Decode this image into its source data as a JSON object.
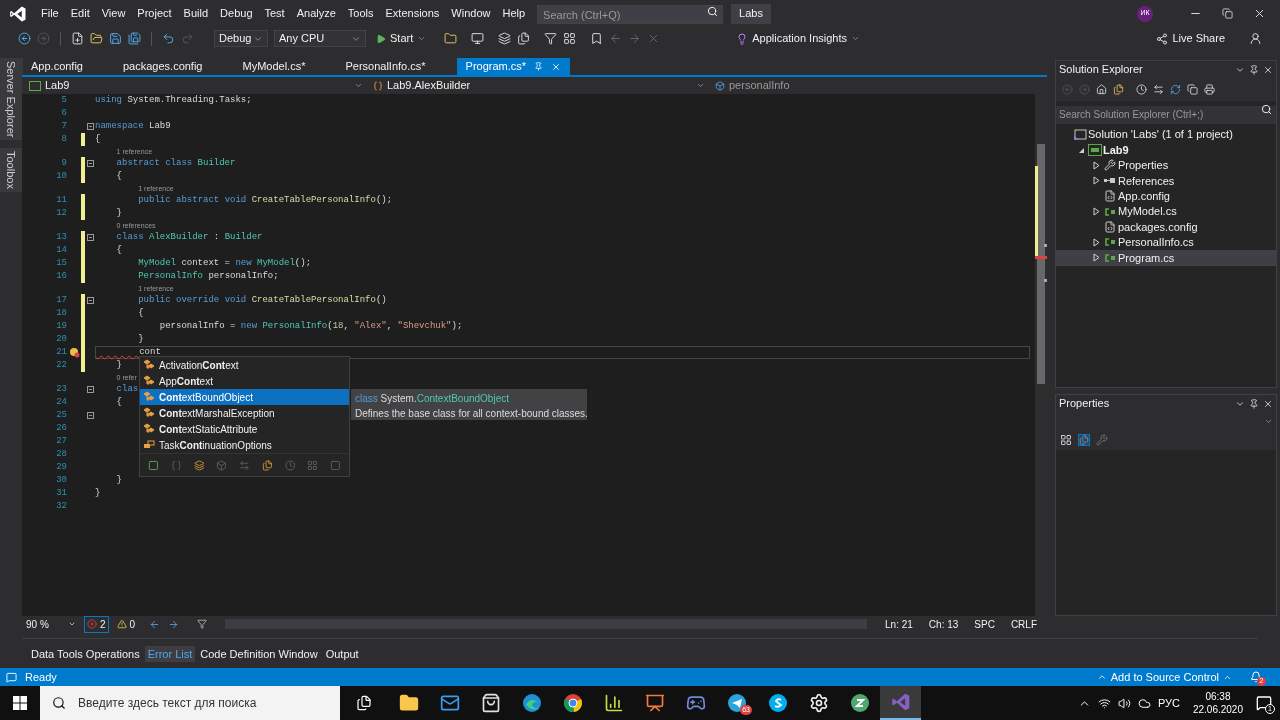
{
  "menu": {
    "items": [
      "File",
      "Edit",
      "View",
      "Project",
      "Build",
      "Debug",
      "Test",
      "Analyze",
      "Tools",
      "Extensions",
      "Window",
      "Help"
    ],
    "search": {
      "placeholder": "Search (Ctrl+Q)"
    },
    "solution_name": "Labs",
    "avatar": "ИК"
  },
  "toolbar": {
    "configuration": "Debug",
    "platform": "Any CPU",
    "start": "Start",
    "insights": "Application Insights",
    "live_share": "Live Share"
  },
  "side_tabs": [
    "Server Explorer",
    "Toolbox"
  ],
  "doc_tabs": [
    {
      "label": "App.config",
      "selected": false
    },
    {
      "label": "packages.config",
      "selected": false
    },
    {
      "label": "MyModel.cs*",
      "selected": false
    },
    {
      "label": "PersonalInfo.cs*",
      "selected": false
    },
    {
      "label": "Program.cs*",
      "selected": true
    }
  ],
  "nav_bar": {
    "project": "Lab9",
    "type": "Lab9.AlexBuilder",
    "member": "personalInfo"
  },
  "code": [
    {
      "num": "5",
      "fold": false,
      "changed": false,
      "current": false,
      "error": false,
      "tokens": [
        {
          "kind": "kw",
          "text": "using"
        },
        {
          "kind": "plain",
          "text": " System.Threading.Tasks;"
        }
      ]
    },
    {
      "num": "6",
      "fold": false,
      "changed": false,
      "current": false,
      "error": false
    },
    {
      "num": "7",
      "fold": true,
      "changed": false,
      "current": false,
      "error": false,
      "tokens": [
        {
          "kind": "kw",
          "text": "namespace"
        },
        {
          "kind": "plain",
          "text": " Lab9"
        }
      ]
    },
    {
      "num": "8",
      "fold": false,
      "changed": true,
      "current": false,
      "error": false,
      "tokens": [
        {
          "kind": "plain",
          "text": "{"
        }
      ]
    },
    {
      "num": "9",
      "lens": "1 reference",
      "fold": true,
      "changed": true,
      "current": false,
      "error": false,
      "tokens": [
        {
          "kind": "kw",
          "text": "    abstract"
        },
        {
          "kind": "kw",
          "text": " class"
        },
        {
          "kind": "type",
          "text": " Builder"
        }
      ]
    },
    {
      "num": "10",
      "fold": false,
      "changed": true,
      "current": false,
      "error": false,
      "tokens": [
        {
          "kind": "plain",
          "text": "    {"
        }
      ]
    },
    {
      "num": "11",
      "lens": "1 reference",
      "fold": false,
      "changed": true,
      "current": false,
      "error": false,
      "tokens": [
        {
          "kind": "kw",
          "text": "        public"
        },
        {
          "kind": "kw",
          "text": " abstract"
        },
        {
          "kind": "kw",
          "text": " void"
        },
        {
          "kind": "method",
          "text": " CreateTablePersonalInfo"
        },
        {
          "kind": "plain",
          "text": "();"
        }
      ]
    },
    {
      "num": "12",
      "fold": false,
      "changed": true,
      "current": false,
      "error": false,
      "tokens": [
        {
          "kind": "plain",
          "text": "    }"
        }
      ]
    },
    {
      "num": "13",
      "lens": "0 references",
      "fold": true,
      "changed": true,
      "current": false,
      "error": false,
      "tokens": [
        {
          "kind": "kw",
          "text": "    class"
        },
        {
          "kind": "type",
          "text": " AlexBuilder"
        },
        {
          "kind": "plain",
          "text": " :"
        },
        {
          "kind": "type",
          "text": " Builder"
        }
      ]
    },
    {
      "num": "14",
      "fold": false,
      "changed": true,
      "current": false,
      "error": false,
      "tokens": [
        {
          "kind": "plain",
          "text": "    {"
        }
      ]
    },
    {
      "num": "15",
      "fold": false,
      "changed": true,
      "current": false,
      "error": false,
      "tokens": [
        {
          "kind": "type",
          "text": "        MyModel"
        },
        {
          "kind": "plain",
          "text": " context ="
        },
        {
          "kind": "kw",
          "text": " new"
        },
        {
          "kind": "type",
          "text": " MyModel"
        },
        {
          "kind": "plain",
          "text": "();"
        }
      ]
    },
    {
      "num": "16",
      "fold": false,
      "changed": true,
      "current": false,
      "error": false,
      "tokens": [
        {
          "kind": "type",
          "text": "        PersonalInfo"
        },
        {
          "kind": "plain",
          "text": " personalInfo;"
        }
      ]
    },
    {
      "num": "17",
      "lens": "1 reference",
      "fold": true,
      "changed": true,
      "current": false,
      "error": false,
      "tokens": [
        {
          "kind": "kw",
          "text": "        public"
        },
        {
          "kind": "kw",
          "text": " override"
        },
        {
          "kind": "kw",
          "text": " void"
        },
        {
          "kind": "method",
          "text": " CreateTablePersonalInfo"
        },
        {
          "kind": "plain",
          "text": "()"
        }
      ]
    },
    {
      "num": "18",
      "fold": false,
      "changed": true,
      "current": false,
      "error": false,
      "tokens": [
        {
          "kind": "plain",
          "text": "        {"
        }
      ]
    },
    {
      "num": "19",
      "fold": false,
      "changed": true,
      "current": false,
      "error": false,
      "tokens": [
        {
          "kind": "plain",
          "text": "            personalInfo ="
        },
        {
          "kind": "kw",
          "text": " new"
        },
        {
          "kind": "type",
          "text": " PersonalInfo"
        },
        {
          "kind": "plain",
          "text": "("
        },
        {
          "kind": "num",
          "text": "18"
        },
        {
          "kind": "plain",
          "text": ","
        },
        {
          "kind": "str",
          "text": " \"Alex\""
        },
        {
          "kind": "plain",
          "text": ","
        },
        {
          "kind": "str",
          "text": " \"Shevchuk\""
        },
        {
          "kind": "plain",
          "text": ");"
        }
      ]
    },
    {
      "num": "20",
      "fold": false,
      "changed": true,
      "current": false,
      "error": false,
      "tokens": [
        {
          "kind": "plain",
          "text": "        }"
        }
      ]
    },
    {
      "num": "21",
      "fold": false,
      "changed": true,
      "current": true,
      "error": true,
      "tokens": [
        {
          "kind": "plain",
          "text": "        cont"
        }
      ]
    },
    {
      "num": "22",
      "fold": false,
      "changed": true,
      "current": false,
      "error": false,
      "tokens": [
        {
          "kind": "plain",
          "text": "    }"
        }
      ]
    },
    {
      "num": "23",
      "lens": "0 refer",
      "fold": true,
      "changed": false,
      "current": false,
      "error": false,
      "tokens": [
        {
          "kind": "kw",
          "text": "    clas"
        }
      ]
    },
    {
      "num": "24",
      "fold": false,
      "changed": false,
      "current": false,
      "error": false,
      "tokens": [
        {
          "kind": "plain",
          "text": "    {"
        }
      ]
    },
    {
      "num": "25",
      "fold": true,
      "changed": false,
      "current": false,
      "error": false
    },
    {
      "num": "26",
      "fold": false,
      "changed": false,
      "current": false,
      "error": false
    },
    {
      "num": "27",
      "fold": false,
      "changed": false,
      "current": false,
      "error": false
    },
    {
      "num": "28",
      "fold": false,
      "changed": false,
      "current": false,
      "error": false
    },
    {
      "num": "29",
      "fold": false,
      "changed": false,
      "current": false,
      "error": false
    },
    {
      "num": "30",
      "fold": false,
      "changed": false,
      "current": false,
      "error": false,
      "tokens": [
        {
          "kind": "plain",
          "text": "    }"
        }
      ]
    },
    {
      "num": "31",
      "fold": false,
      "changed": false,
      "current": false,
      "error": false,
      "tokens": [
        {
          "kind": "plain",
          "text": "}"
        }
      ]
    },
    {
      "num": "32",
      "fold": false,
      "changed": false,
      "current": false,
      "error": false
    }
  ],
  "completion": {
    "items": [
      {
        "kind": "class",
        "text": "Activation**Cont**ext",
        "selected": false
      },
      {
        "kind": "class",
        "text": "App**Cont**ext",
        "selected": false
      },
      {
        "kind": "class",
        "text": "**Cont**extBoundObject",
        "selected": true
      },
      {
        "kind": "class",
        "text": "**Cont**extMarshalException",
        "selected": false
      },
      {
        "kind": "class",
        "text": "**Cont**extStaticAttribute",
        "selected": false
      },
      {
        "kind": "enum",
        "text": "Task**Cont**inuationOptions",
        "selected": false
      }
    ],
    "tooltip": {
      "keyword": "class",
      "namespace": "System.",
      "type": "ContextBoundObject",
      "description": "Defines the base class for all context-bound classes."
    }
  },
  "editor_status": {
    "zoom": "90 %",
    "errors": "2",
    "warnings": "0",
    "line": "Ln: 21",
    "column": "Ch: 13",
    "whitespace": "SPC",
    "line_endings": "CRLF"
  },
  "tool_tabs": [
    {
      "label": "Data Tools Operations",
      "selected": false
    },
    {
      "label": "Error List",
      "selected": true
    },
    {
      "label": "Code Definition Window",
      "selected": false
    },
    {
      "label": "Output",
      "selected": false
    }
  ],
  "solution_explorer": {
    "title": "Solution Explorer",
    "search": {
      "placeholder": "Search Solution Explorer (Ctrl+;)"
    },
    "tree": [
      {
        "kind": "solution",
        "label": "Solution 'Labs' (1 of 1 project)",
        "expandable": false,
        "selected": false,
        "children": [
          {
            "kind": "project",
            "label": "Lab9",
            "expandable": true,
            "expanded": true,
            "selected": false,
            "children": [
              {
                "kind": "wrench",
                "label": "Properties",
                "expandable": true,
                "expanded": false,
                "selected": false
              },
              {
                "kind": "references",
                "label": "References",
                "expandable": true,
                "expanded": false,
                "selected": false
              },
              {
                "kind": "config",
                "label": "App.config",
                "expandable": false,
                "selected": false
              },
              {
                "kind": "cs",
                "label": "MyModel.cs",
                "expandable": true,
                "expanded": false,
                "selected": false
              },
              {
                "kind": "config",
                "label": "packages.config",
                "expandable": false,
                "selected": false
              },
              {
                "kind": "cs",
                "label": "PersonalInfo.cs",
                "expandable": true,
                "expanded": false,
                "selected": false
              },
              {
                "kind": "cs",
                "label": "Program.cs",
                "expandable": true,
                "expanded": false,
                "selected": true
              }
            ]
          }
        ]
      }
    ]
  },
  "properties": {
    "title": "Properties"
  },
  "status_bar": {
    "text": "Ready",
    "source_control": "Add to Source Control",
    "notifications": "2"
  },
  "taskbar": {
    "search": {
      "placeholder": "Введите здесь текст для поиска"
    },
    "apps": [
      {
        "kind": "folder",
        "active": false
      },
      {
        "kind": "mail",
        "active": false
      },
      {
        "kind": "bag",
        "active": false
      },
      {
        "kind": "swirl",
        "active": false
      },
      {
        "kind": "browser",
        "active": false
      },
      {
        "kind": "chart",
        "active": false
      },
      {
        "kind": "slides",
        "active": false
      },
      {
        "kind": "gamepad",
        "active": false
      },
      {
        "kind": "plane",
        "active": false,
        "badge": "63"
      },
      {
        "kind": "skype",
        "active": false
      },
      {
        "kind": "gear",
        "active": false
      },
      {
        "kind": "zcircle",
        "active": false
      },
      {
        "kind": "vs",
        "active": true
      }
    ],
    "language": "РУС",
    "time": "06:38",
    "date": "22.06.2020",
    "notifications": "1"
  }
}
